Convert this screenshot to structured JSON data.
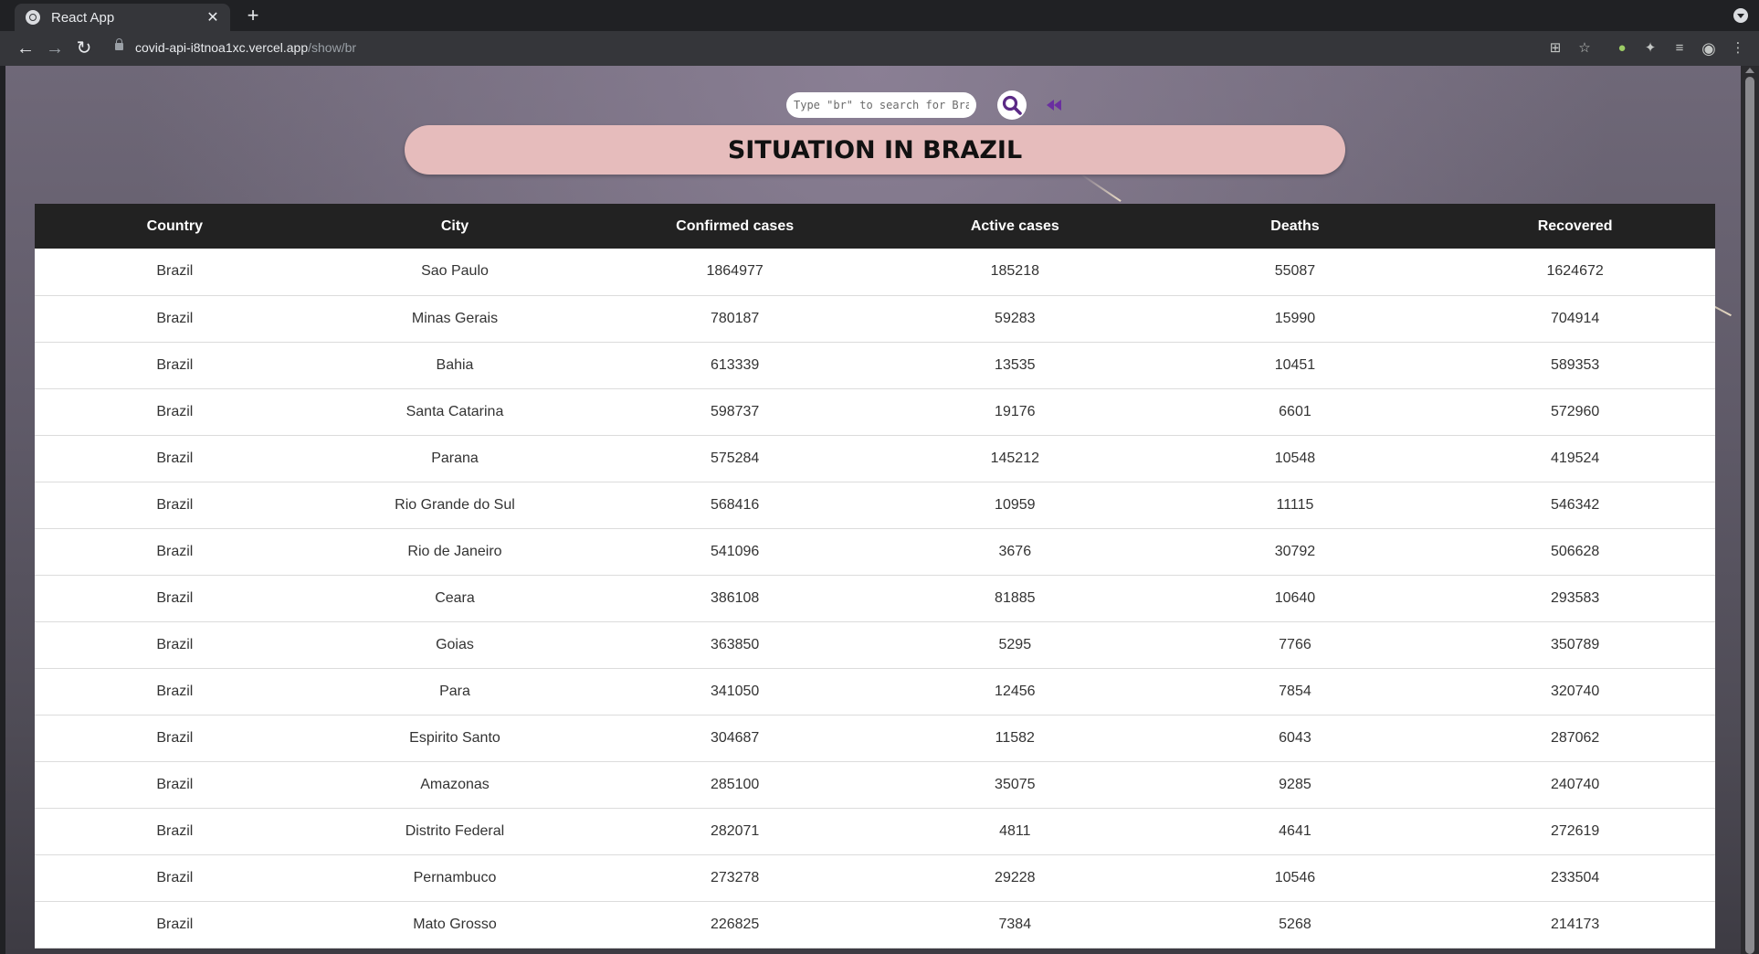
{
  "browser": {
    "tab_title": "React App",
    "tab_close": "✕",
    "new_tab": "+",
    "url_host": "covid-api-i8tnoa1xc.vercel.app",
    "url_path": "/show/br"
  },
  "search": {
    "placeholder": "Type \"br\" to search for Brazil"
  },
  "banner": {
    "title": "SITUATION IN BRAZIL"
  },
  "colors": {
    "banner_bg": "#e6bcbc",
    "header_bg": "#222222",
    "search_icon": "#5b2a86",
    "back_icon": "#6a2fa0"
  },
  "icons": {
    "search": "magnifier-icon",
    "back": "rewind-icon"
  },
  "table": {
    "headers": [
      "Country",
      "City",
      "Confirmed cases",
      "Active cases",
      "Deaths",
      "Recovered"
    ],
    "rows": [
      [
        "Brazil",
        "Sao Paulo",
        "1864977",
        "185218",
        "55087",
        "1624672"
      ],
      [
        "Brazil",
        "Minas Gerais",
        "780187",
        "59283",
        "15990",
        "704914"
      ],
      [
        "Brazil",
        "Bahia",
        "613339",
        "13535",
        "10451",
        "589353"
      ],
      [
        "Brazil",
        "Santa Catarina",
        "598737",
        "19176",
        "6601",
        "572960"
      ],
      [
        "Brazil",
        "Parana",
        "575284",
        "145212",
        "10548",
        "419524"
      ],
      [
        "Brazil",
        "Rio Grande do Sul",
        "568416",
        "10959",
        "11115",
        "546342"
      ],
      [
        "Brazil",
        "Rio de Janeiro",
        "541096",
        "3676",
        "30792",
        "506628"
      ],
      [
        "Brazil",
        "Ceara",
        "386108",
        "81885",
        "10640",
        "293583"
      ],
      [
        "Brazil",
        "Goias",
        "363850",
        "5295",
        "7766",
        "350789"
      ],
      [
        "Brazil",
        "Para",
        "341050",
        "12456",
        "7854",
        "320740"
      ],
      [
        "Brazil",
        "Espirito Santo",
        "304687",
        "11582",
        "6043",
        "287062"
      ],
      [
        "Brazil",
        "Amazonas",
        "285100",
        "35075",
        "9285",
        "240740"
      ],
      [
        "Brazil",
        "Distrito Federal",
        "282071",
        "4811",
        "4641",
        "272619"
      ],
      [
        "Brazil",
        "Pernambuco",
        "273278",
        "29228",
        "10546",
        "233504"
      ],
      [
        "Brazil",
        "Mato Grosso",
        "226825",
        "7384",
        "5268",
        "214173"
      ]
    ]
  }
}
